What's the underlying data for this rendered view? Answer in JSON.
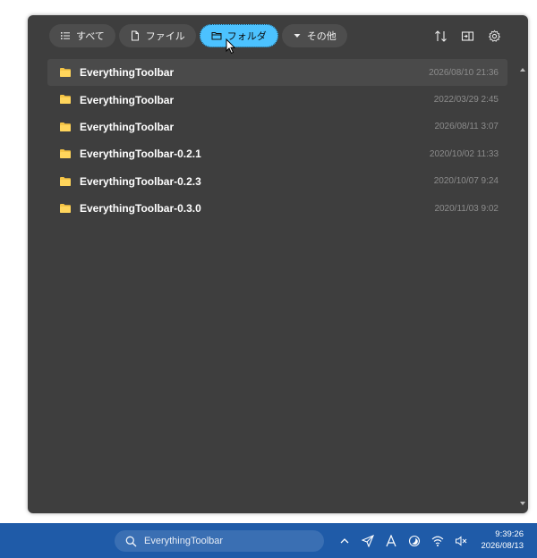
{
  "filters": [
    {
      "label": "すべて",
      "icon": "list-icon",
      "active": false
    },
    {
      "label": "ファイル",
      "icon": "file-icon",
      "active": false
    },
    {
      "label": "フォルダ",
      "icon": "folder-outline-icon",
      "active": true
    },
    {
      "label": "その他",
      "icon": "caret-down-icon",
      "active": false
    }
  ],
  "toolbar": {
    "sort_icon": "sort-icon",
    "preview_icon": "preview-pane-icon",
    "settings_icon": "gear-icon"
  },
  "results": [
    {
      "name": "EverythingToolbar",
      "date": "2026/08/10 21:36"
    },
    {
      "name": "EverythingToolbar",
      "date": "2022/03/29 2:45"
    },
    {
      "name": "EverythingToolbar",
      "date": "2026/08/11 3:07"
    },
    {
      "name": "EverythingToolbar-0.2.1",
      "date": "2020/10/02 11:33"
    },
    {
      "name": "EverythingToolbar-0.2.3",
      "date": "2020/10/07 9:24"
    },
    {
      "name": "EverythingToolbar-0.3.0",
      "date": "2020/11/03 9:02"
    }
  ],
  "taskbar": {
    "search_text": "EverythingToolbar",
    "time": "9:39:26",
    "date": "2026/08/13",
    "tray_icons": [
      "chevron-up-icon",
      "send-icon",
      "font-icon",
      "moon-icon",
      "wifi-icon",
      "mute-icon"
    ]
  },
  "colors": {
    "panel_bg": "#3e3e3e",
    "accent": "#4cc2ff",
    "folder": "#f5c445",
    "taskbar": "#1f5ba8"
  }
}
